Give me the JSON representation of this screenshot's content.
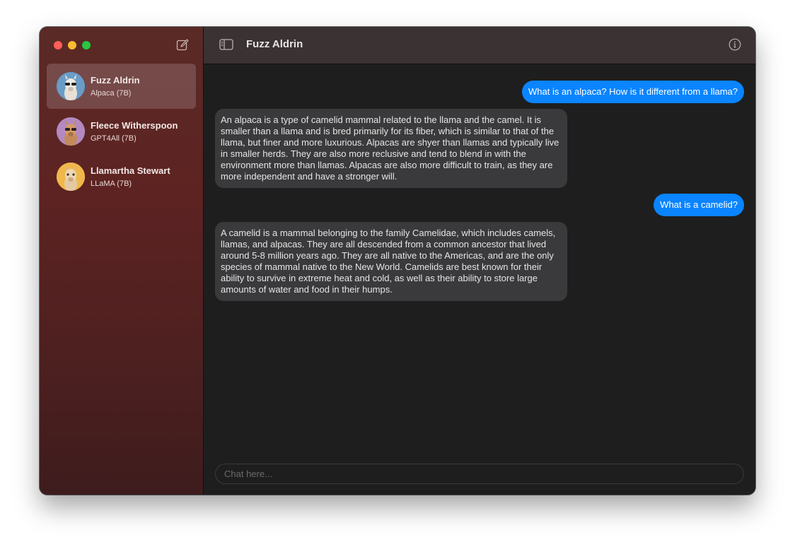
{
  "window": {
    "title": "Fuzz Aldrin"
  },
  "sidebar": {
    "chats": [
      {
        "name": "Fuzz Aldrin",
        "model": "Alpaca (7B)",
        "active": true,
        "avatar_color": "#4a7fb0"
      },
      {
        "name": "Fleece Witherspoon",
        "model": "GPT4All (7B)",
        "active": false,
        "avatar_color": "#b07ab8"
      },
      {
        "name": "Llamartha Stewart",
        "model": "LLaMA (7B)",
        "active": false,
        "avatar_color": "#e0a640"
      }
    ]
  },
  "messages": [
    {
      "role": "user",
      "text": "What is an alpaca? How is it different from a llama?"
    },
    {
      "role": "assistant",
      "text": "An alpaca is a type of camelid mammal related to the llama and the camel. It is smaller than a llama and is bred primarily for its fiber, which is similar to that of the llama, but finer and more luxurious. Alpacas are shyer than llamas and typically live in smaller herds. They are also more reclusive and tend to blend in with the environment more than llamas. Alpacas are also more difficult to train, as they are more independent and have a stronger will."
    },
    {
      "role": "user",
      "text": "What is a camelid?"
    },
    {
      "role": "assistant",
      "text": "A camelid is a mammal belonging to the family Camelidae, which includes camels, llamas, and alpacas. They are all descended from a common ancestor that lived around 5-8 million years ago. They are all native to the Americas, and are the only species of mammal native to the New World. Camelids are best known for their ability to survive in extreme heat and cold, as well as their ability to store large amounts of water and food in their humps."
    }
  ],
  "composer": {
    "placeholder": "Chat here...",
    "value": ""
  },
  "colors": {
    "accent": "#0a84ff",
    "bot_bubble": "#3a3a3c"
  }
}
